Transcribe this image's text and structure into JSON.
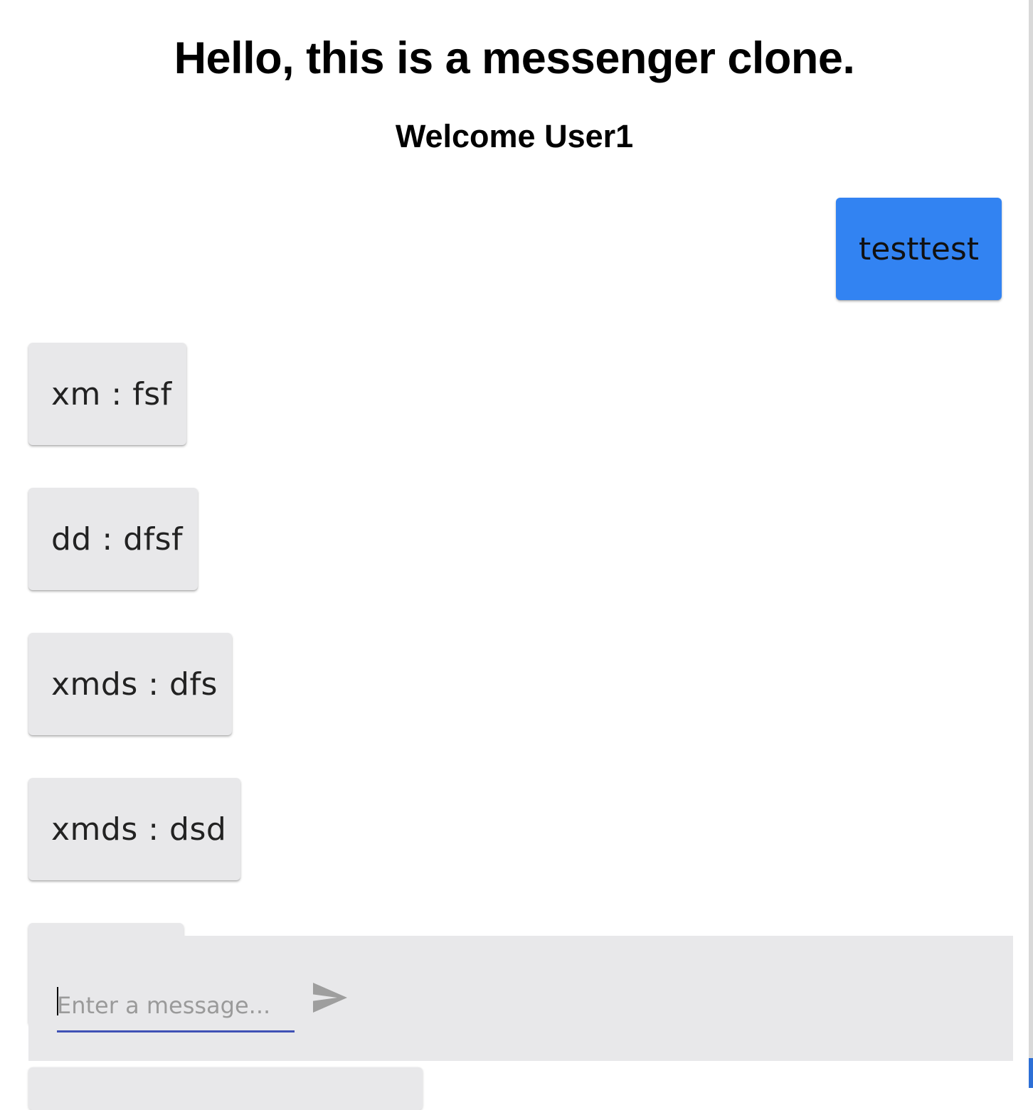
{
  "header": {
    "title": "Hello, this is a messenger clone.",
    "welcome": "Welcome User1"
  },
  "messages": [
    {
      "text": "testtest",
      "own": true
    },
    {
      "text": "xm : fsf",
      "own": false
    },
    {
      "text": "dd : dfsf",
      "own": false
    },
    {
      "text": "xmds : dfs",
      "own": false
    },
    {
      "text": "xmds : dsd",
      "own": false
    }
  ],
  "composer": {
    "placeholder": "Enter a message...",
    "value": "",
    "send_icon": "send-icon"
  },
  "colors": {
    "own_bubble": "#3283f2",
    "other_bubble": "#e8e8ea",
    "input_underline": "#3f51b5"
  }
}
